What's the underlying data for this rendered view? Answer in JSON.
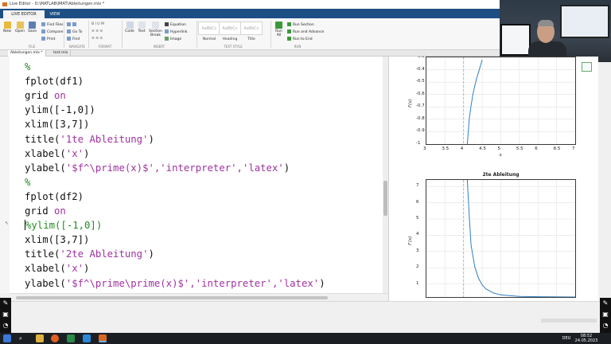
{
  "window": {
    "title": "Live Editor - D:\\MATLAB\\IMAT\\Ableitungen.mlx *"
  },
  "ribbon": {
    "tabs": [
      "LIVE EDITOR",
      "VIEW"
    ],
    "file": {
      "new": "New",
      "open": "Open",
      "save": "Save",
      "find_files": "Find Files",
      "compare": "Compare",
      "print": "Print",
      "group": "FILE"
    },
    "navigate": {
      "go_to": "Go To",
      "find": "Find",
      "group": "NAVIGATE"
    },
    "text_group": "FORMAT",
    "insert": {
      "code": "Code",
      "text": "Text",
      "section_break": "Section Break",
      "equation": "Equation",
      "hyperlink": "Hyperlink",
      "image": "Image",
      "group": "INSERT"
    },
    "text_style": {
      "styles": [
        {
          "preview": "AaBbCc",
          "label": "Normal"
        },
        {
          "preview": "AaBbCc",
          "label": "Heading"
        },
        {
          "preview": "AaBbCc",
          "label": "Title"
        }
      ],
      "group": "TEXT STYLE"
    },
    "run": {
      "run_all": "Run All",
      "run_section": "Run Section",
      "run_advance": "Run and Advance",
      "run_to_end": "Run to End",
      "group": "RUN"
    }
  },
  "file_tabs": [
    "Ableitungen.mlx *",
    "test.mlx"
  ],
  "code": {
    "lines": [
      {
        "text": "%",
        "kind": "comment"
      },
      {
        "text": "fplot(df1)",
        "kind": "plain"
      },
      {
        "pre": "grid ",
        "kw": "on",
        "kind": "grid"
      },
      {
        "text": "ylim([-1,0])",
        "kind": "plain"
      },
      {
        "text": "xlim([3,7])",
        "kind": "plain"
      },
      {
        "pre": "title(",
        "str": "'1te Ableitung'",
        "post": ")",
        "kind": "str"
      },
      {
        "pre": "xlabel(",
        "str": "'x'",
        "post": ")",
        "kind": "str"
      },
      {
        "pre": "ylabel(",
        "str": "'$f^\\prime(x)$','interpreter','latex'",
        "post": ")",
        "kind": "str"
      },
      {
        "text": "%",
        "kind": "comment"
      },
      {
        "text": "fplot(df2)",
        "kind": "plain"
      },
      {
        "pre": "grid ",
        "kw": "on",
        "kind": "grid"
      },
      {
        "text": "%ylim([-1,0])",
        "kind": "comment-caret"
      },
      {
        "text": "xlim([3,7])",
        "kind": "plain"
      },
      {
        "pre": "title(",
        "str": "'2te Ableitung'",
        "post": ")",
        "kind": "str"
      },
      {
        "pre": "xlabel(",
        "str": "'x'",
        "post": ")",
        "kind": "str"
      },
      {
        "pre": "ylabel(",
        "str": "'$f^\\prime\\prime(x)$','interpreter','latex'",
        "post": ")",
        "kind": "str"
      }
    ]
  },
  "chart_data": [
    {
      "type": "line",
      "title": "",
      "xlabel": "x",
      "ylabel": "f′(x)",
      "xlim": [
        3,
        7
      ],
      "ylim": [
        -1,
        -0.3
      ],
      "xticks": [
        "3",
        "3.5",
        "4",
        "4.5",
        "5",
        "5.5",
        "6",
        "6.5",
        "7"
      ],
      "yticks": [
        "-0.3",
        "-0.4",
        "-0.5",
        "-0.6",
        "-0.7",
        "-0.8",
        "-0.9",
        "-1"
      ],
      "grid": true,
      "asymptote_x": 4,
      "x": [
        4.1,
        4.15,
        4.2,
        4.25,
        4.3,
        4.35,
        4.4,
        4.45,
        4.5
      ],
      "y": [
        -1.0,
        -0.8,
        -0.69,
        -0.6,
        -0.53,
        -0.47,
        -0.42,
        -0.37,
        -0.32
      ]
    },
    {
      "type": "line",
      "title": "2te Ableitung",
      "xlabel": "",
      "ylabel": "f″(x)",
      "xlim": [
        3,
        7
      ],
      "ylim": [
        0.2,
        7.4
      ],
      "yticks": [
        "7",
        "6",
        "5",
        "4",
        "3",
        "2",
        "1"
      ],
      "grid": true,
      "asymptote_x": 4,
      "x": [
        4.1,
        4.15,
        4.2,
        4.3,
        4.4,
        4.5,
        4.6,
        4.8,
        5.0,
        5.5,
        6.0,
        7.0
      ],
      "y": [
        7.4,
        5.2,
        3.4,
        2.05,
        1.35,
        0.95,
        0.7,
        0.45,
        0.33,
        0.24,
        0.22,
        0.2
      ]
    }
  ],
  "taskbar": {
    "time": "08:52",
    "date": "24.05.2023",
    "lang": "DEU"
  }
}
